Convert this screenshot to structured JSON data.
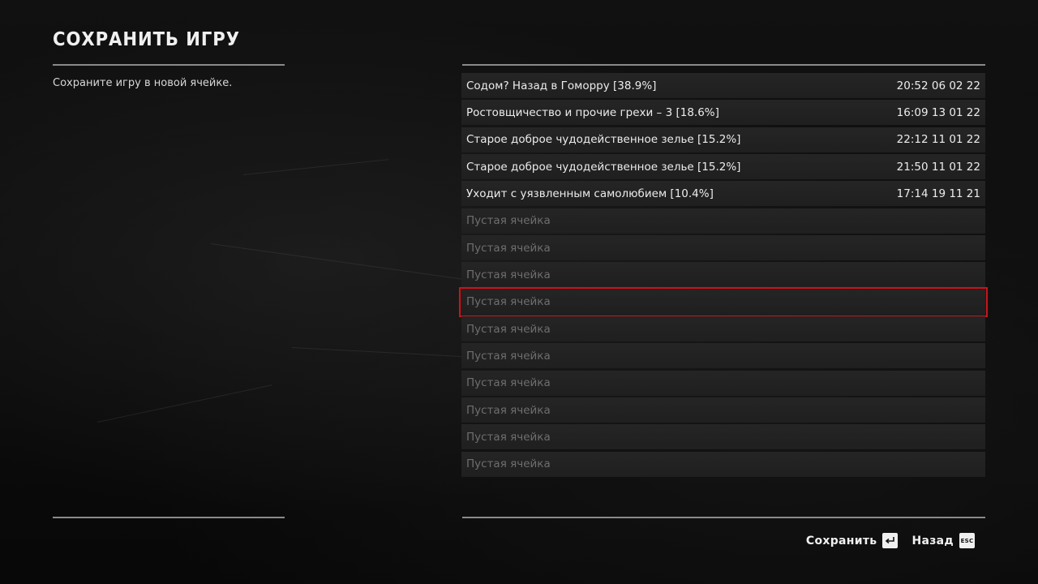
{
  "header": {
    "title": "СОХРАНИТЬ ИГРУ",
    "subtitle": "Сохраните игру в новой ячейке."
  },
  "slots": [
    {
      "name": "Содом? Назад в Гоморру [38.9%]",
      "time": "20:52 06 02 22"
    },
    {
      "name": "Ростовщичество и прочие грехи – 3 [18.6%]",
      "time": "16:09 13 01 22"
    },
    {
      "name": "Старое доброе чудодейственное зелье [15.2%]",
      "time": "22:12 11 01 22"
    },
    {
      "name": "Старое доброе чудодейственное зелье [15.2%]",
      "time": "21:50 11 01 22"
    },
    {
      "name": "Уходит с уязвленным самолюбием [10.4%]",
      "time": "17:14 19 11 21"
    },
    {
      "name": "Пустая ячейка",
      "time": ""
    },
    {
      "name": "Пустая ячейка",
      "time": ""
    },
    {
      "name": "Пустая ячейка",
      "time": ""
    },
    {
      "name": "Пустая ячейка",
      "time": ""
    },
    {
      "name": "Пустая ячейка",
      "time": ""
    },
    {
      "name": "Пустая ячейка",
      "time": ""
    },
    {
      "name": "Пустая ячейка",
      "time": ""
    },
    {
      "name": "Пустая ячейка",
      "time": ""
    },
    {
      "name": "Пустая ячейка",
      "time": ""
    },
    {
      "name": "Пустая ячейка",
      "time": ""
    }
  ],
  "selected_slot_index": 8,
  "footer": {
    "save_label": "Сохранить",
    "save_key_icon": "enter-key-icon",
    "back_label": "Назад",
    "back_key": "ESC"
  },
  "colors": {
    "selection": "#c4161c",
    "background": "#0b0b0b",
    "slot": "#222222",
    "text": "#ececec",
    "empty_text": "#6e6e6e"
  }
}
